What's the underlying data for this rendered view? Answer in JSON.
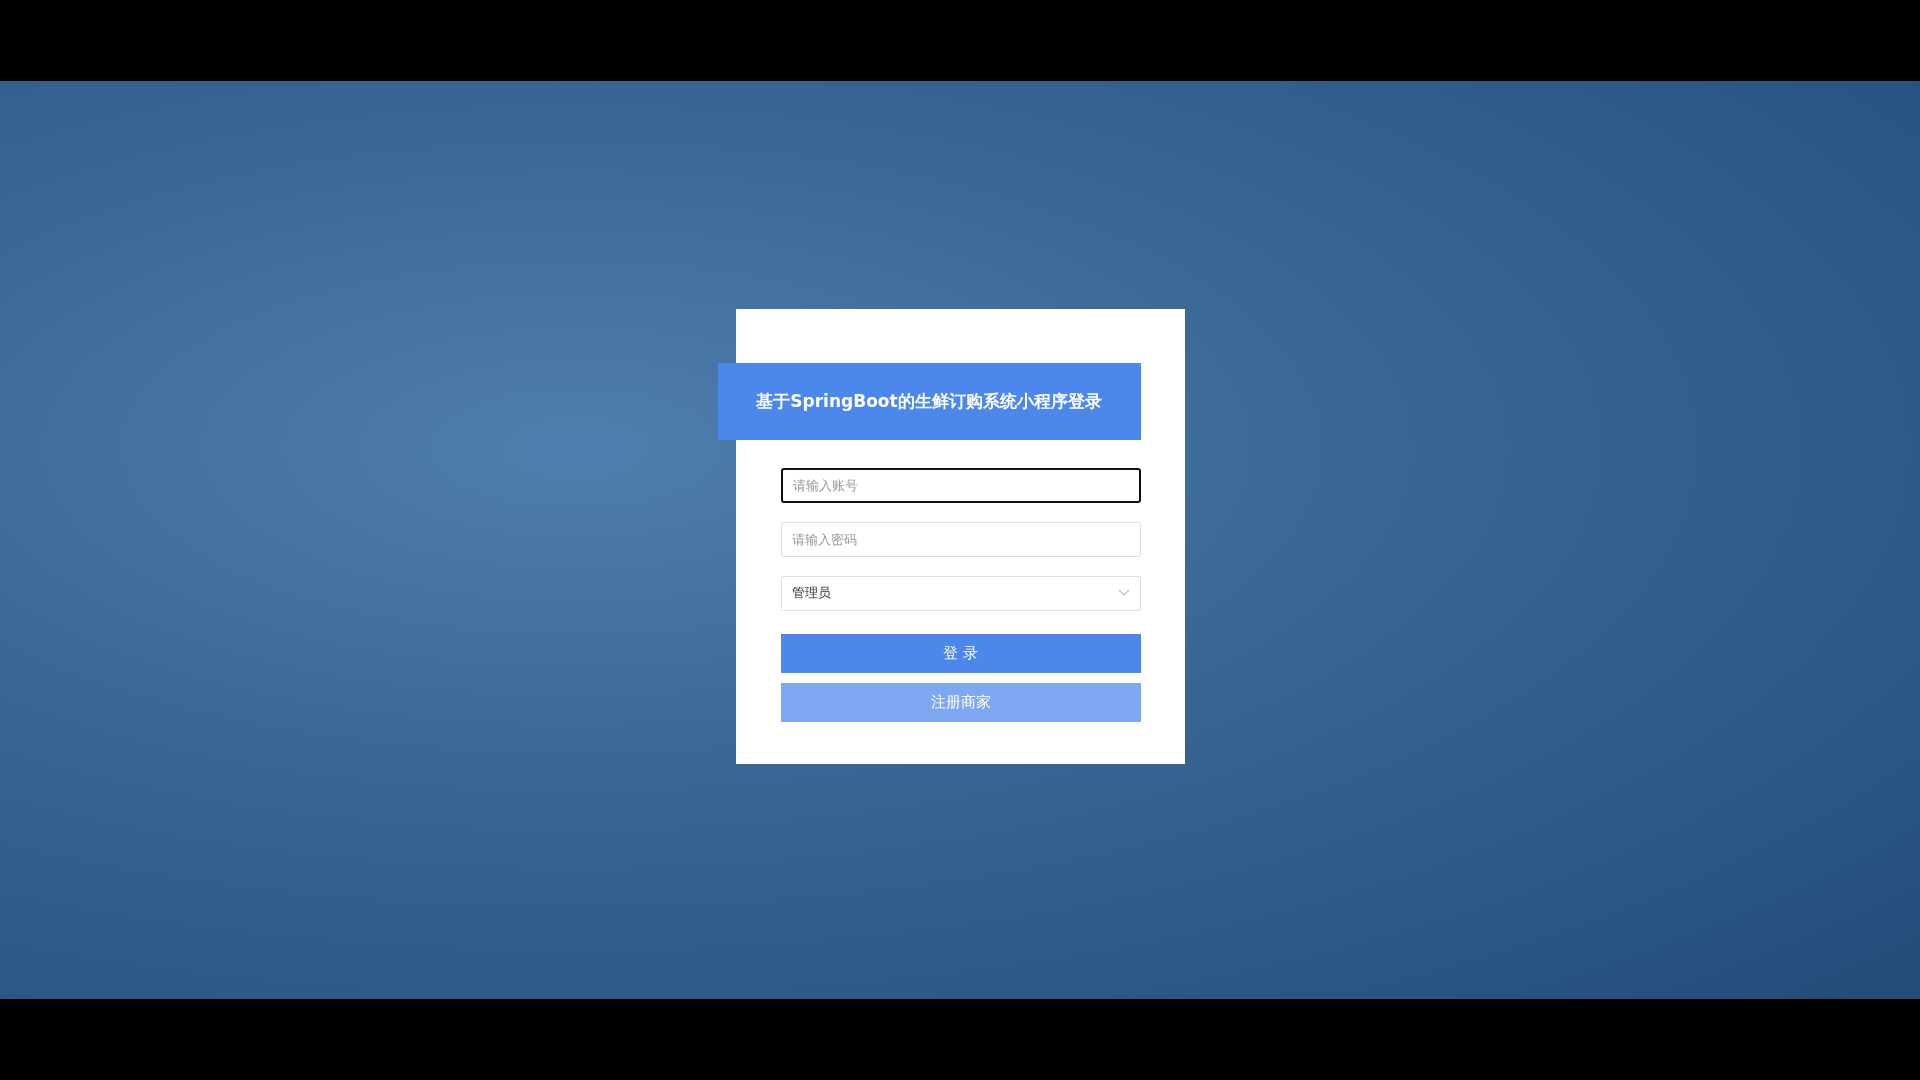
{
  "login_form": {
    "title": "基于SpringBoot的生鲜订购系统小程序登录",
    "fields": [
      {
        "kind": "text",
        "placeholder": "请输入账号",
        "focused": true
      },
      {
        "kind": "password",
        "placeholder": "请输入密码",
        "focused": false
      },
      {
        "kind": "select",
        "value": "管理员",
        "focused": false
      }
    ],
    "buttons": [
      {
        "kind": "primary",
        "label": "登 录"
      },
      {
        "kind": "secondary",
        "label": "注册商家"
      }
    ]
  }
}
